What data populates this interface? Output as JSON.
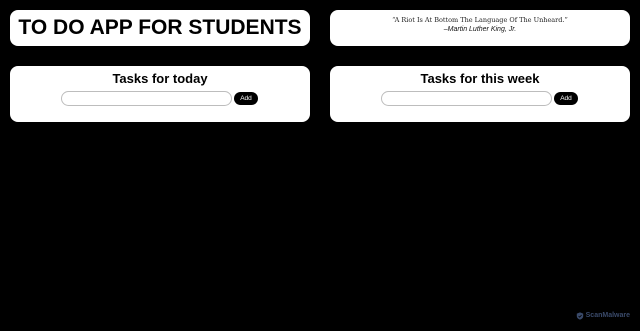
{
  "header": {
    "app_title": "TO DO APP FOR STUDENTS"
  },
  "quote": {
    "text": "“A Riot Is At Bottom The Language Of The Unheard.”",
    "author": "–Martin Luther King, Jr."
  },
  "today": {
    "heading": "Tasks for today",
    "input_value": "",
    "input_placeholder": "",
    "add_label": "Add"
  },
  "week": {
    "heading": "Tasks for this week",
    "input_value": "",
    "input_placeholder": "",
    "add_label": "Add"
  },
  "watermark": {
    "text": "ScanMalware",
    "icon": "shield-logo-icon"
  },
  "colors": {
    "background": "#000000",
    "card": "#ffffff",
    "button": "#000000",
    "button_text": "#ffffff",
    "input_border": "#bdbdbd",
    "watermark": "#3a4a6a"
  }
}
